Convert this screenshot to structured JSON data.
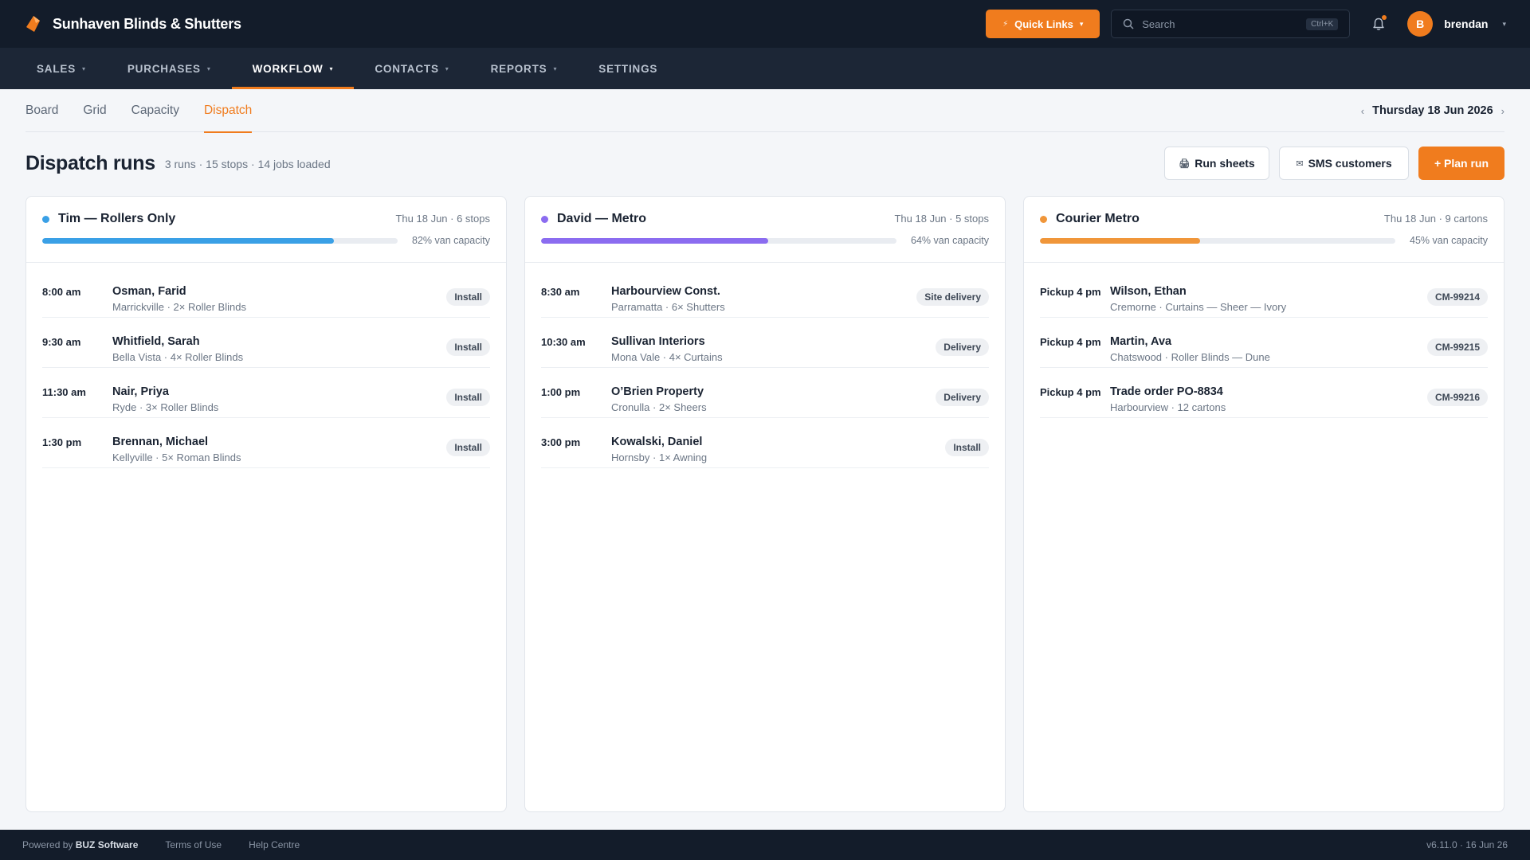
{
  "app": {
    "title": "Sunhaven Blinds & Shutters"
  },
  "topbar": {
    "quick_links_label": "Quick Links",
    "search_placeholder": "Search",
    "search_shortcut": "Ctrl+K",
    "avatar_initial": "B",
    "username": "brendan"
  },
  "nav": {
    "items": [
      {
        "label": "SALES"
      },
      {
        "label": "PURCHASES"
      },
      {
        "label": "WORKFLOW"
      },
      {
        "label": "CONTACTS"
      },
      {
        "label": "REPORTS"
      },
      {
        "label": "SETTINGS"
      }
    ],
    "active": "WORKFLOW"
  },
  "subtabs": {
    "items": [
      {
        "label": "Board"
      },
      {
        "label": "Grid"
      },
      {
        "label": "Capacity"
      },
      {
        "label": "Dispatch"
      }
    ],
    "active": "Dispatch",
    "date": "Thursday 18 Jun 2026"
  },
  "page": {
    "title": "Dispatch runs",
    "summary": "3 runs · 15 stops · 14 jobs loaded",
    "run_sheets_label": "Run sheets",
    "sms_label": "SMS customers",
    "plan_run_label": "+ Plan run"
  },
  "runs": [
    {
      "name": "Tim — Rollers Only",
      "meta": "Thu 18 Jun · 6 stops",
      "color": "#3aa0e6",
      "capacity_pct": 82,
      "capacity_text": "82% van capacity",
      "stops": [
        {
          "time": "8:00 am",
          "name": "Osman, Farid",
          "detail": "Marrickville · 2× Roller Blinds",
          "badge": "Install"
        },
        {
          "time": "9:30 am",
          "name": "Whitfield, Sarah",
          "detail": "Bella Vista · 4× Roller Blinds",
          "badge": "Install"
        },
        {
          "time": "11:30 am",
          "name": "Nair, Priya",
          "detail": "Ryde · 3× Roller Blinds",
          "badge": "Install"
        },
        {
          "time": "1:30 pm",
          "name": "Brennan, Michael",
          "detail": "Kellyville · 5× Roman Blinds",
          "badge": "Install"
        }
      ]
    },
    {
      "name": "David — Metro",
      "meta": "Thu 18 Jun · 5 stops",
      "color": "#8b6cf0",
      "capacity_pct": 64,
      "capacity_text": "64% van capacity",
      "stops": [
        {
          "time": "8:30 am",
          "name": "Harbourview Const.",
          "detail": "Parramatta · 6× Shutters",
          "badge": "Site delivery"
        },
        {
          "time": "10:30 am",
          "name": "Sullivan Interiors",
          "detail": "Mona Vale · 4× Curtains",
          "badge": "Delivery"
        },
        {
          "time": "1:00 pm",
          "name": "O’Brien Property",
          "detail": "Cronulla · 2× Sheers",
          "badge": "Delivery"
        },
        {
          "time": "3:00 pm",
          "name": "Kowalski, Daniel",
          "detail": "Hornsby · 1× Awning",
          "badge": "Install"
        }
      ]
    },
    {
      "name": "Courier Metro",
      "meta": "Thu 18 Jun · 9 cartons",
      "color": "#f0963a",
      "capacity_pct": 45,
      "capacity_text": "45% van capacity",
      "stops": [
        {
          "time": "Pickup 4 pm",
          "name": "Wilson, Ethan",
          "detail": "Cremorne · Curtains — Sheer — Ivory",
          "badge": "CM-99214"
        },
        {
          "time": "Pickup 4 pm",
          "name": "Martin, Ava",
          "detail": "Chatswood · Roller Blinds — Dune",
          "badge": "CM-99215"
        },
        {
          "time": "Pickup 4 pm",
          "name": "Trade order PO-8834",
          "detail": "Harbourview · 12 cartons",
          "badge": "CM-99216"
        }
      ]
    }
  ],
  "footer": {
    "powered_prefix": "Powered by",
    "powered_brand": "BUZ Software",
    "terms": "Terms of Use",
    "help": "Help Centre",
    "version": "v6.11.0 · 16 Jun 26"
  },
  "colors": {
    "accent": "#f07c1e",
    "topbar": "#131c2a",
    "nav": "#1c2636"
  }
}
